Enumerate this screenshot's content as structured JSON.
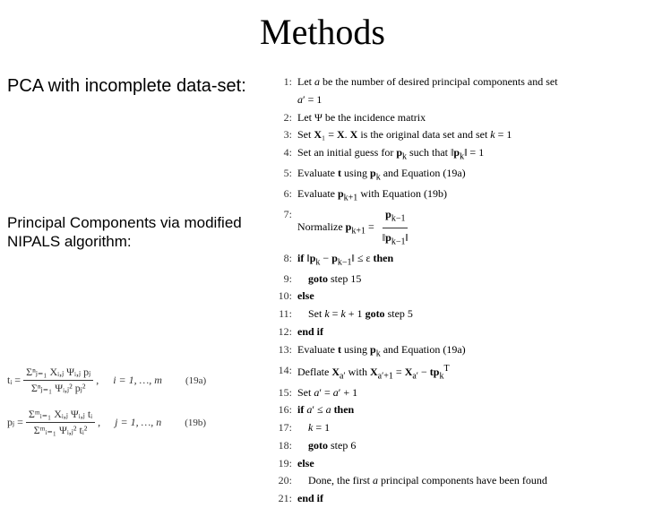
{
  "title": "Methods",
  "subtitle1": "PCA with incomplete data-set:",
  "subtitle2_line1": "Principal Components via modified",
  "subtitle2_line2": "NIPALS algorithm:",
  "algo": {
    "1": "Let a be the number of desired principal components and set",
    "1b": "a′ = 1",
    "2": "Let Ψ be the incidence matrix",
    "3": "Set X₁ = X. X is the original data set and set k = 1",
    "4": "Set an initial guess for pₖ such that ‖pₖ‖ = 1",
    "5": "Evaluate t using pₖ and Equation (19a)",
    "6": "Evaluate pₖ₊₁ with Equation (19b)",
    "7": "Normalize pₖ₊₁ = pₖ₋₁ / ‖pₖ₋₁‖",
    "8": "if ‖pₖ − pₖ₋₁‖ ≤ ε then",
    "9": "    goto step 15",
    "10": "else",
    "11": "    Set k = k + 1 goto step 5",
    "12": "end if",
    "13": "Evaluate t using pₖ and Equation (19a)",
    "14": "Deflate Xₐ′ with Xₐ′₊₁ = Xₐ′ − tpₖᵀ",
    "15": "Set a′ = a′ + 1",
    "16": "if a′ ≤ a then",
    "17": "    k = 1",
    "18": "    goto step 6",
    "19": "else",
    "20": "    Done, the first a principal components have been found",
    "21": "end if"
  },
  "formulas": {
    "t_lhs": "tᵢ =",
    "t_num": "Σⁿⱼ₌₁ Xᵢ,ⱼ Ψᵢ,ⱼ pⱼ",
    "t_den": "Σⁿⱼ₌₁ Ψᵢ,ⱼ² pⱼ²",
    "t_dom": "i = 1, …, m",
    "t_lbl": "(19a)",
    "p_lhs": "pⱼ =",
    "p_num": "Σᵐᵢ₌₁ Xᵢ,ⱼ Ψᵢ,ⱼ tᵢ",
    "p_den": "Σᵐᵢ₌₁ Ψᵢ,ⱼ² tᵢ²",
    "p_dom": "j = 1, …, n",
    "p_lbl": "(19b)"
  }
}
